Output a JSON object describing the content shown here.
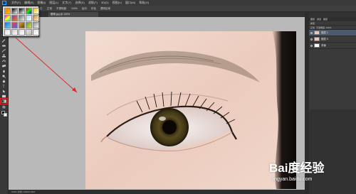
{
  "menubar": {
    "items": [
      "文件(F)",
      "编辑(E)",
      "图像(I)",
      "图层(L)",
      "文字(Y)",
      "选择(S)",
      "滤镜(T)",
      "3D(D)",
      "视图(V)",
      "窗口(W)",
      "帮助(H)"
    ]
  },
  "optionsbar": {
    "mode_label": "模式:",
    "mode_value": "正常",
    "opacity_label": "不透明度:",
    "opacity_value": "100%",
    "reverse_label": "反向",
    "dither_label": "仿色",
    "transparency_label": "透明区域"
  },
  "document_tab": {
    "label": "眼睛.jpg @ 100%"
  },
  "toolbar": {
    "tools": [
      "move-tool",
      "marquee-tool",
      "lasso-tool",
      "quick-select-tool",
      "crop-tool",
      "eyedropper-tool",
      "healing-tool",
      "brush-tool",
      "clone-tool",
      "history-brush-tool",
      "eraser-tool",
      "gradient-tool",
      "blur-tool",
      "dodge-tool",
      "pen-tool",
      "type-tool",
      "path-select-tool",
      "shape-tool",
      "hand-tool",
      "zoom-tool"
    ],
    "highlight": "gradient-tool",
    "foreground_color": "#000000",
    "background_color": "#ffffff"
  },
  "gradient_presets": {
    "swatches": [
      [
        "#e7a11b",
        "#ff8c00",
        "#f5e000"
      ],
      [
        "#000000",
        "#ffffff"
      ],
      [
        "#000000",
        "#ffffff"
      ],
      [
        "#ff0000",
        "#00ff00",
        "#0000ff"
      ],
      [
        "#f0c000",
        "#ffffff"
      ],
      [
        "#ff00ff",
        "#ffff00",
        "#00ffff"
      ],
      [
        "#7a3fb5",
        "#ff7d00"
      ],
      [
        "#6e6e6e",
        "#f0f0f0"
      ],
      [
        "#b6d4ff",
        "#ffffff"
      ],
      [
        "#c48a3a",
        "#fff2c8"
      ],
      [
        "#1f6fd8",
        "#5dd3f3"
      ],
      [
        "#ff3a3a",
        "#3a6bff"
      ],
      [
        "#d7a62a",
        "#6d3b10"
      ],
      [
        "#5a9c3c",
        "#e6d84a"
      ],
      [
        "#8f8f8f",
        "#f4f4f4"
      ],
      [
        "#e0e0e0",
        "#ffffff"
      ],
      [
        "#cccccc",
        "#ffffff"
      ],
      [
        "#dddddd",
        "#ffffff"
      ],
      [
        "#e6e6e6",
        "#bbbbbb"
      ],
      [
        "#e4e4e4",
        "#ffffff"
      ]
    ]
  },
  "layers_panel": {
    "tabs": [
      "图层",
      "通道",
      "路径"
    ],
    "kind_label": "类型",
    "blend_mode": "正常",
    "opacity": "不透明度: 100%",
    "layers": [
      {
        "name": "图层 1",
        "active": true
      },
      {
        "name": "图层 0",
        "active": false
      },
      {
        "name": "背景",
        "active": false
      }
    ]
  },
  "statusbar": {
    "text": "100%   文档:1.02M/1.02M"
  },
  "watermark": {
    "logo": "Bai度经验",
    "url": "jingyan.baidu.com"
  },
  "colors": {
    "annotation": "#e02a2a",
    "canvas_bg": "#b9b9b9",
    "app_bg": "#282828"
  }
}
